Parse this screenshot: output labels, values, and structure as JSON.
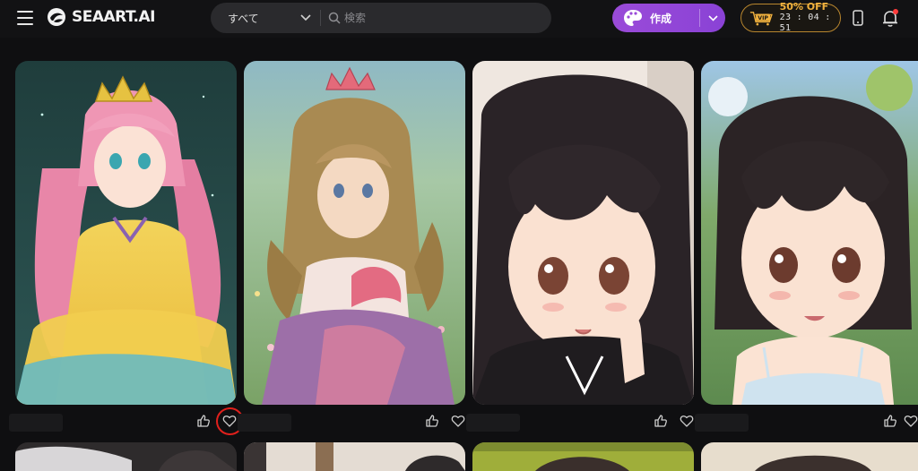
{
  "header": {
    "logo_text": "SEAART.AI",
    "search": {
      "scope_label": "すべて",
      "placeholder": "検索",
      "value": ""
    },
    "create_label": "作成",
    "vip": {
      "badge": "VIP",
      "offer": "50% OFF",
      "countdown": "23 : 04 : 51"
    }
  },
  "colors": {
    "background": "#0f0f11",
    "search_bg": "#2a2a2d",
    "create_accent": "#9a4bd8",
    "vip_gold": "#f0b13e",
    "notification_dot": "#ff3b3b",
    "highlight_ring": "#e0201c"
  },
  "gallery": {
    "cards": [
      {
        "subject": "pink-haired princess in yellow dress",
        "actions": [
          "like-icon",
          "favorite-icon"
        ]
      },
      {
        "subject": "watercolor princess in meadow",
        "actions": [
          "like-icon",
          "favorite-icon"
        ]
      },
      {
        "subject": "black-haired anime girl pointing",
        "actions": [
          "like-icon",
          "favorite-icon"
        ]
      },
      {
        "subject": "dark-haired girl in sundress outdoors",
        "actions": [
          "like-icon",
          "favorite-icon"
        ]
      }
    ]
  }
}
